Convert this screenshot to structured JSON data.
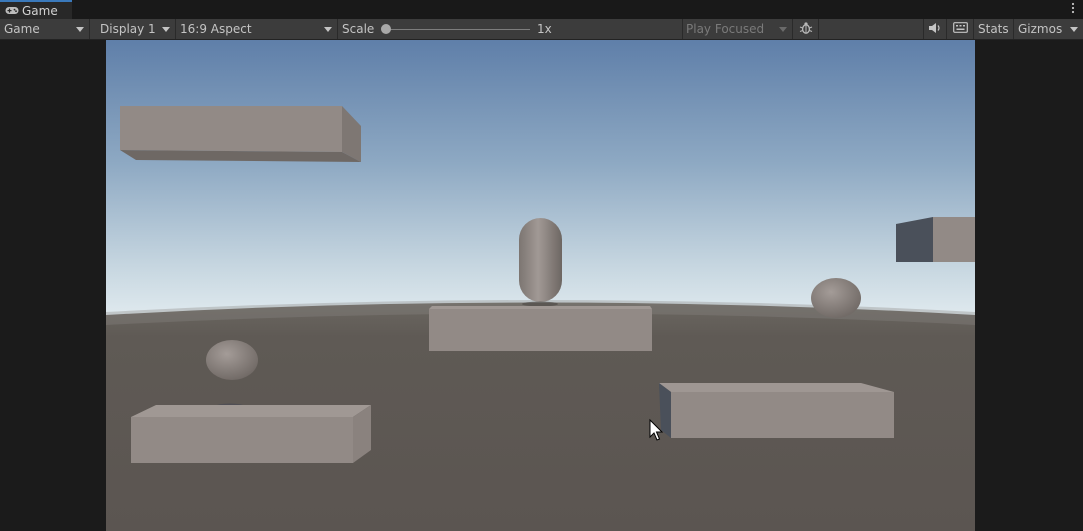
{
  "tab": {
    "title": "Game"
  },
  "toolbar": {
    "mode": "Game",
    "display": "Display 1",
    "aspect": "16:9 Aspect",
    "scale_label": "Scale",
    "scale_value": "1x",
    "scale_fraction": 0.0,
    "play_mode": "Play Focused",
    "stats": "Stats",
    "gizmos": "Gizmos"
  },
  "icons": {
    "tab": "gamepad-icon",
    "menu": "more-vertical-icon",
    "debug": "bug-icon",
    "audio": "speaker-icon",
    "keyboard": "keyboard-icon",
    "cursor": "mouse-pointer-icon"
  },
  "colors": {
    "sky_top": "#5f7fa9",
    "sky_horizon": "#dfe9ee",
    "ground": "#5d5852",
    "object": "#928a86",
    "accent": "#3a79bb"
  }
}
